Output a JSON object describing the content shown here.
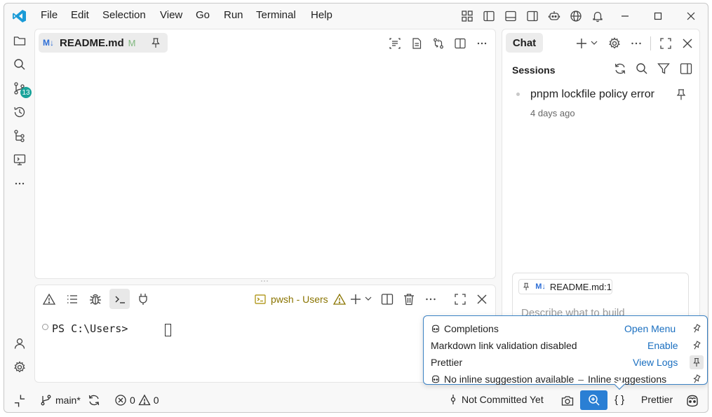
{
  "menu": [
    "File",
    "Edit",
    "Selection",
    "View",
    "Go",
    "Run",
    "Terminal",
    "Help"
  ],
  "activity_badge": "13",
  "editor": {
    "tab_badge": "M↓",
    "tab_name": "README.md",
    "tab_modified": "M"
  },
  "terminal": {
    "profile_label": "pwsh - Users",
    "prompt": "PS C:\\Users> "
  },
  "chat": {
    "title": "Chat",
    "sessions_title": "Sessions",
    "session_name": "pnpm lockfile policy error",
    "session_time": "4 days ago",
    "context_badge": "M↓",
    "context_file": "README.md:1",
    "input_placeholder": "Describe what to build"
  },
  "popup": {
    "rows": [
      {
        "label": "Completions",
        "action": "Open Menu"
      },
      {
        "label": "Markdown link validation disabled",
        "action": "Enable"
      },
      {
        "label": "Prettier",
        "action": "View Logs"
      },
      {
        "label": "No inline suggestion available",
        "sep": "–",
        "action": "Inline suggestions"
      }
    ]
  },
  "status": {
    "branch": "main*",
    "errors": "0",
    "warnings": "0",
    "blame": "Not Committed Yet",
    "braces": "{ }",
    "prettier": "Prettier"
  },
  "colors": {
    "accent": "#2a7fd4",
    "warning": "#a68b00",
    "link": "#1a6fc0",
    "badge": "#1aa39a"
  }
}
